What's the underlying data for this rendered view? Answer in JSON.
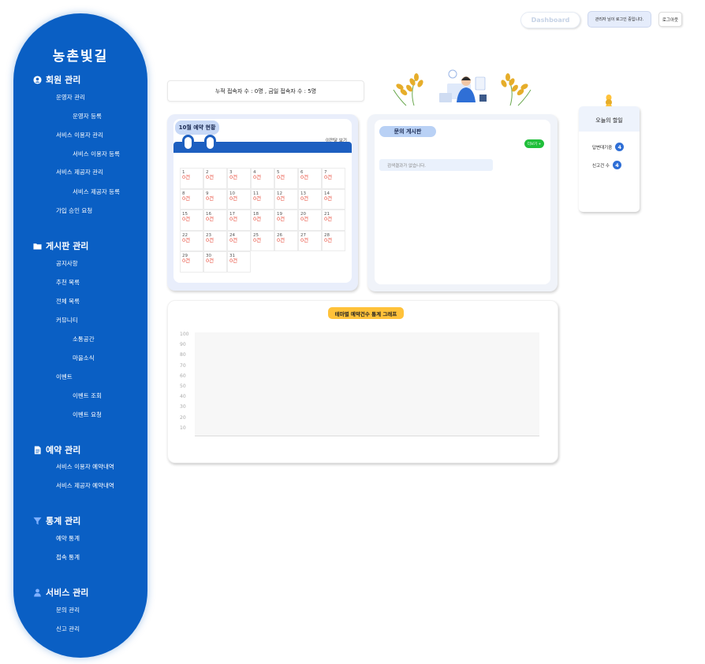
{
  "app": {
    "logo": "농촌빛길"
  },
  "colors": {
    "sidebar": "#0a5fc4",
    "accent": "#1d5fc0",
    "count_red": "#e84b3a",
    "more_green": "#20bf3a",
    "chart_title_bg": "#ffc23a"
  },
  "header": {
    "dashboard": "Dashboard",
    "login_msg": "관리자 님이 로그인 중입니다.",
    "logout": "로그아웃"
  },
  "sidebar": {
    "member": {
      "title": "회원 관리",
      "icon": "user-circle-icon",
      "items": [
        "운영자 관리",
        "운영자 등록",
        "서비스 이용자 관리",
        "서비스 이용자 등록",
        "서비스 제공자 관리",
        "서비스 제공자 등록",
        "가입 승인 요청"
      ]
    },
    "board": {
      "title": "게시판 관리",
      "icon": "folder-icon",
      "items": [
        "공지사항",
        "추천 목록",
        "전체 목록",
        "커뮤니티",
        "소통공간",
        "마을소식",
        "이벤트",
        "이벤트 조회",
        "이벤트 요청"
      ]
    },
    "reservation": {
      "title": "예약 관리",
      "icon": "document-icon",
      "items": [
        "서비스 이용자 예약내역",
        "서비스 제공자 예약내역"
      ]
    },
    "stats": {
      "title": "통계 관리",
      "icon": "filter-icon",
      "items": [
        "예약 통계",
        "접속 통계"
      ]
    },
    "service": {
      "title": "서비스 관리",
      "icon": "person-icon",
      "items": [
        "문의 관리",
        "신고 관리"
      ]
    }
  },
  "visitors": {
    "text": "누적 접속자 수 : 0명 , 금일 접속자 수 : 5명"
  },
  "calendar": {
    "title": "10월 예약 현황",
    "prev_link": "이전달 보기",
    "days": [
      {
        "d": "1",
        "c": "0건"
      },
      {
        "d": "2",
        "c": "0건"
      },
      {
        "d": "3",
        "c": "0건"
      },
      {
        "d": "4",
        "c": "0건"
      },
      {
        "d": "5",
        "c": "0건"
      },
      {
        "d": "6",
        "c": "0건"
      },
      {
        "d": "7",
        "c": "0건"
      },
      {
        "d": "8",
        "c": "0건"
      },
      {
        "d": "9",
        "c": "0건"
      },
      {
        "d": "10",
        "c": "0건"
      },
      {
        "d": "11",
        "c": "0건"
      },
      {
        "d": "12",
        "c": "0건"
      },
      {
        "d": "13",
        "c": "0건"
      },
      {
        "d": "14",
        "c": "0건"
      },
      {
        "d": "15",
        "c": "0건"
      },
      {
        "d": "16",
        "c": "0건"
      },
      {
        "d": "17",
        "c": "0건"
      },
      {
        "d": "18",
        "c": "0건"
      },
      {
        "d": "19",
        "c": "0건"
      },
      {
        "d": "20",
        "c": "0건"
      },
      {
        "d": "21",
        "c": "0건"
      },
      {
        "d": "22",
        "c": "0건"
      },
      {
        "d": "23",
        "c": "0건"
      },
      {
        "d": "24",
        "c": "0건"
      },
      {
        "d": "25",
        "c": "0건"
      },
      {
        "d": "26",
        "c": "0건"
      },
      {
        "d": "27",
        "c": "0건"
      },
      {
        "d": "28",
        "c": "0건"
      },
      {
        "d": "29",
        "c": "0건"
      },
      {
        "d": "30",
        "c": "0건"
      },
      {
        "d": "31",
        "c": "0건"
      }
    ]
  },
  "inquiry": {
    "title": "문의 게시판",
    "more": "더보기 +",
    "empty": "검색결과가 없습니다."
  },
  "todo": {
    "title": "오늘의 할일",
    "items": [
      {
        "label": "답변대기중",
        "count": "4"
      },
      {
        "label": "신고건 수",
        "count": "4"
      }
    ]
  },
  "chart_data": {
    "type": "bar",
    "title": "테마별 예약건수 통계 그래프",
    "categories": [],
    "values": [],
    "yticks": [
      100,
      90,
      80,
      70,
      60,
      50,
      40,
      30,
      20,
      10
    ],
    "ylim": [
      0,
      100
    ],
    "grid": false
  }
}
